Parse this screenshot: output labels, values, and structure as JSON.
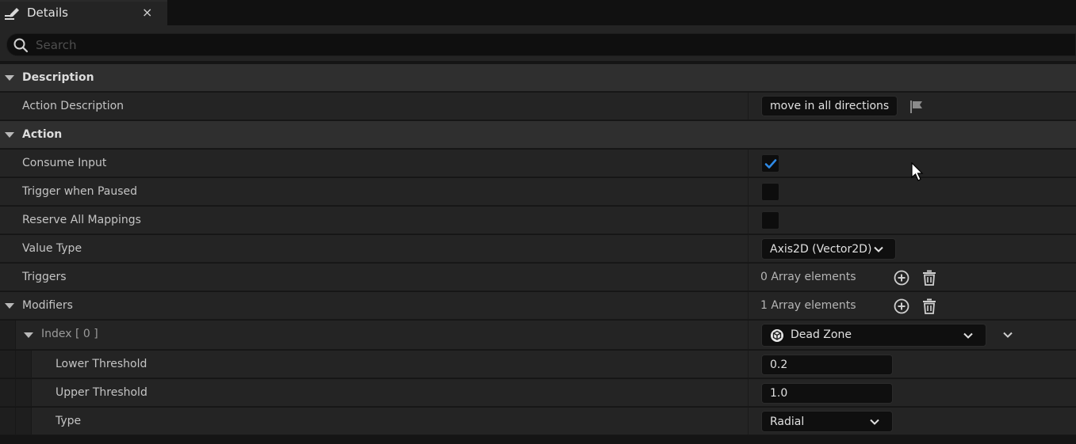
{
  "tab": {
    "title": "Details",
    "icon": "details-pencil-icon",
    "close_glyph": "×"
  },
  "search": {
    "placeholder": "Search",
    "value": "",
    "icon": "search-icon"
  },
  "description": {
    "category": "Description",
    "action_description": {
      "label": "Action Description",
      "value": "move in all directions",
      "icon": "flag-icon"
    }
  },
  "action": {
    "category": "Action",
    "consume_input": {
      "label": "Consume Input",
      "checked": true
    },
    "trigger_when_paused": {
      "label": "Trigger when Paused",
      "checked": false
    },
    "reserve_all_mappings": {
      "label": "Reserve All Mappings",
      "checked": false
    },
    "value_type": {
      "label": "Value Type",
      "value": "Axis2D (Vector2D)"
    },
    "triggers": {
      "label": "Triggers",
      "count_text": "0 Array elements"
    },
    "modifiers": {
      "label": "Modifiers",
      "count_text": "1 Array elements",
      "index": {
        "label": "Index [ 0 ]",
        "value": "Dead Zone",
        "lower_threshold": {
          "label": "Lower Threshold",
          "value": "0.2"
        },
        "upper_threshold": {
          "label": "Upper Threshold",
          "value": "1.0"
        },
        "type": {
          "label": "Type",
          "value": "Radial"
        }
      }
    }
  },
  "colors": {
    "accent_check": "#2f8ae6",
    "panel_bg": "#242424",
    "category_bg": "#2f2f2f",
    "field_bg": "#0f0f0f"
  }
}
